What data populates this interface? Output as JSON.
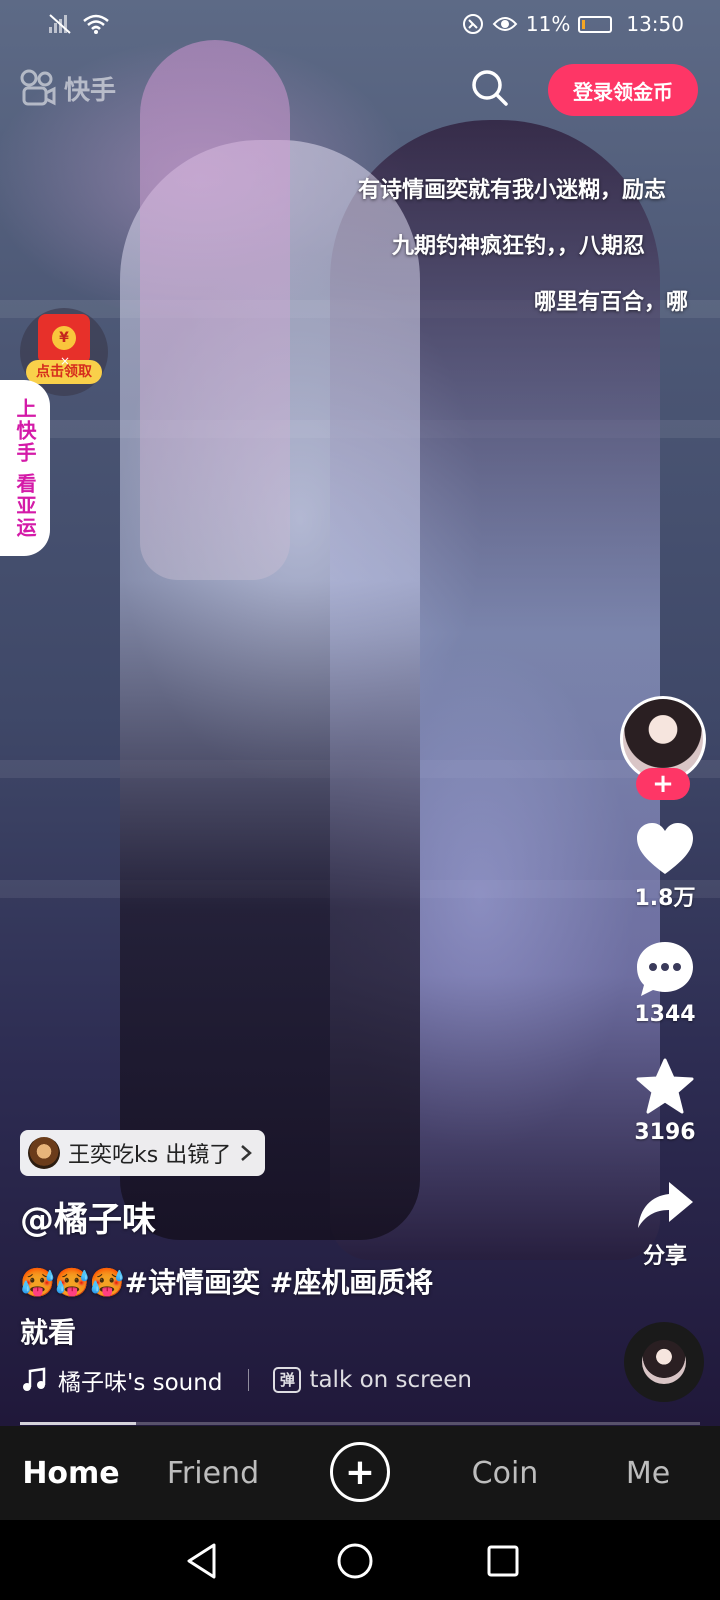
{
  "status_bar": {
    "signal_icon": "no-sim-signal-icon",
    "wifi_icon": "wifi-icon",
    "icons": [
      "nfc-icon",
      "eye-comfort-icon"
    ],
    "battery_percent": "11%",
    "battery_level": 0.11,
    "time": "13:50"
  },
  "header": {
    "logo_text": "快手",
    "search_icon": "search-icon",
    "login_button": "登录领金币"
  },
  "danmaku": [
    "有诗情画奕就有我小迷糊，励志",
    "九期钓神疯狂钓，，八期忍",
    "哪里有百合，哪"
  ],
  "red_packet": {
    "label": "点击领取",
    "coin_symbol": "¥",
    "close_symbol": "×"
  },
  "side_banner": {
    "text": "上快手 看亚运"
  },
  "rail": {
    "follow_symbol": "+",
    "like_count": "1.8万",
    "comment_count": "1344",
    "favorite_count": "3196",
    "share_label": "分享"
  },
  "post": {
    "cameo_text": "王奕吃ks 出镜了",
    "username": "@橘子味",
    "caption_emoji": "🥵🥵🥵",
    "caption_text": "#诗情画奕 #座机画质将",
    "caption_line2": "就看",
    "sound_name": "橘子味's sound",
    "danmu_box": "弹",
    "danmu_label": "talk on screen",
    "progress": 0.17
  },
  "nav": {
    "home": "Home",
    "friend": "Friend",
    "plus": "+",
    "coin": "Coin",
    "me": "Me"
  },
  "colors": {
    "accent": "#fe3666",
    "nav_bg": "#161616",
    "badge_yellow": "#f9d04a"
  }
}
